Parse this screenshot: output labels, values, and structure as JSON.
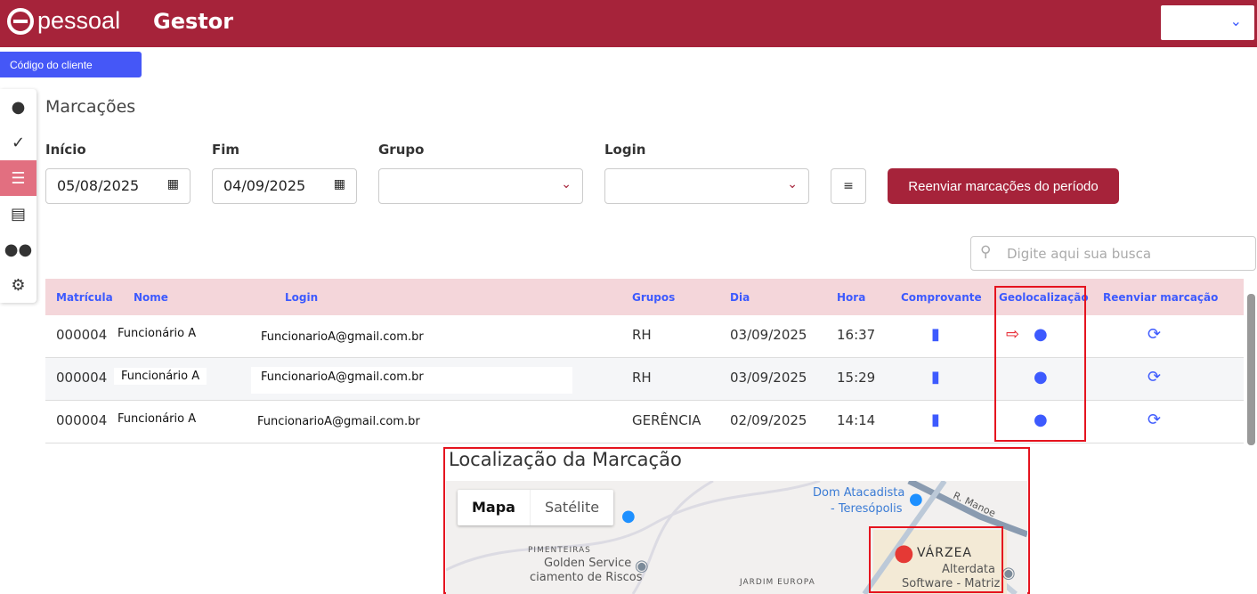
{
  "header": {
    "logo": "pessoal",
    "app": "Gestor"
  },
  "client_code_button": "Código do cliente",
  "page_title": "Marcações",
  "filters": {
    "inicio_label": "Início",
    "inicio_value": "05/08/2025",
    "fim_label": "Fim",
    "fim_value": "04/09/2025",
    "grupo_label": "Grupo",
    "grupo_value": "",
    "login_label": "Login",
    "login_value": "",
    "resend_button": "Reenviar marcações do período"
  },
  "search": {
    "placeholder": "Digite aqui sua busca"
  },
  "table": {
    "columns": [
      "Matrícula",
      "Nome",
      "Login",
      "Grupos",
      "Dia",
      "Hora",
      "Comprovante",
      "Geolocalização",
      "Reenviar marcação"
    ],
    "rows": [
      {
        "matricula": "000004",
        "nome": "Funcionário A",
        "login": "FuncionarioA@gmail.com.br",
        "grupo": "RH",
        "dia": "03/09/2025",
        "hora": "16:37"
      },
      {
        "matricula": "000004",
        "nome": "Funcionário A",
        "login": "FuncionarioA@gmail.com.br",
        "grupo": "RH",
        "dia": "03/09/2025",
        "hora": "15:29"
      },
      {
        "matricula": "000004",
        "nome": "Funcionário A",
        "login": "FuncionarioA@gmail.com.br",
        "grupo": "GERÊNCIA",
        "dia": "02/09/2025",
        "hora": "14:14"
      }
    ]
  },
  "map": {
    "title": "Localização da Marcação",
    "type_map": "Mapa",
    "type_satellite": "Satélite",
    "labels": {
      "dom1": "Dom Atacadista",
      "dom2": "- Teresópolis",
      "road": "R. Manoe",
      "pimenteiras": "PIMENTEIRAS",
      "golden1": "Golden Service",
      "golden2": "ciamento de Riscos",
      "jardim": "JARDIM EUROPA",
      "varzea": "VÁRZEA",
      "alter1": "Alterdata",
      "alter2": "Software - Matriz"
    }
  }
}
